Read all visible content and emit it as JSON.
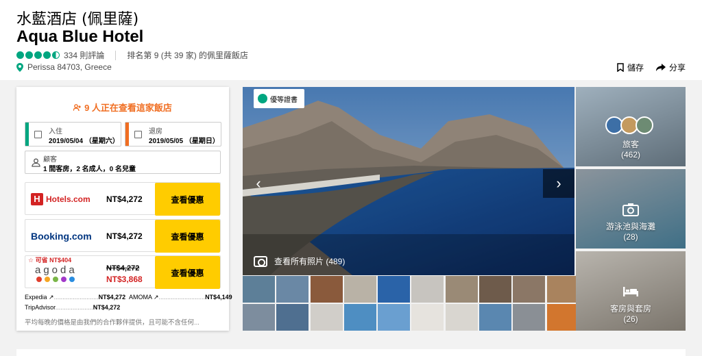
{
  "header": {
    "title_cn": "水藍酒店 (佩里薩)",
    "title_en": "Aqua Blue Hotel",
    "rating": 4.5,
    "reviews": "334 則評論",
    "ranking": "排名第 9 (共 39 家) 的佩里薩飯店",
    "address": "Perissa 84703, Greece",
    "save_label": "儲存",
    "share_label": "分享"
  },
  "booking": {
    "viewers": "9 人正在查看這家飯店",
    "checkin_label": "入住",
    "checkin_value": "2019/05/04 （星期六）",
    "checkout_label": "退房",
    "checkout_value": "2019/05/05 （星期日）",
    "guests_label": "顧客",
    "guests_value": "1 間客房，2 名成人，0 名兒童",
    "offers": [
      {
        "provider": "Hotels.com",
        "price": "NT$4,272",
        "button": "查看優惠"
      },
      {
        "provider": "Booking.com",
        "price": "NT$4,272",
        "button": "查看優惠"
      },
      {
        "provider": "agoda",
        "save": "可省 NT$404",
        "old_price": "NT$4,272",
        "price": "NT$3,868",
        "button": "查看優惠"
      }
    ],
    "others": [
      {
        "name": "Expedia ↗",
        "price": "NT$4,272"
      },
      {
        "name": "AMOMA ↗",
        "price": "NT$4,149"
      },
      {
        "name": "TripAdvisor",
        "price": "NT$4,272"
      }
    ],
    "disclaimer": "平均每晚的價格是由我們的合作夥伴提供，且可能不含任何..."
  },
  "gallery": {
    "badge": "優等證書",
    "all_photos": "查看所有照片 (489)",
    "tiles": [
      {
        "label": "旅客",
        "count": "(462)"
      },
      {
        "label": "游泳池與海灘",
        "count": "(28)"
      },
      {
        "label": "客房與套房",
        "count": "(26)"
      }
    ]
  },
  "colors": {
    "accent_green": "#00a680",
    "viewers_orange": "#f06e22",
    "deal_button": "#ffcc00",
    "deal_red": "#d32323"
  }
}
